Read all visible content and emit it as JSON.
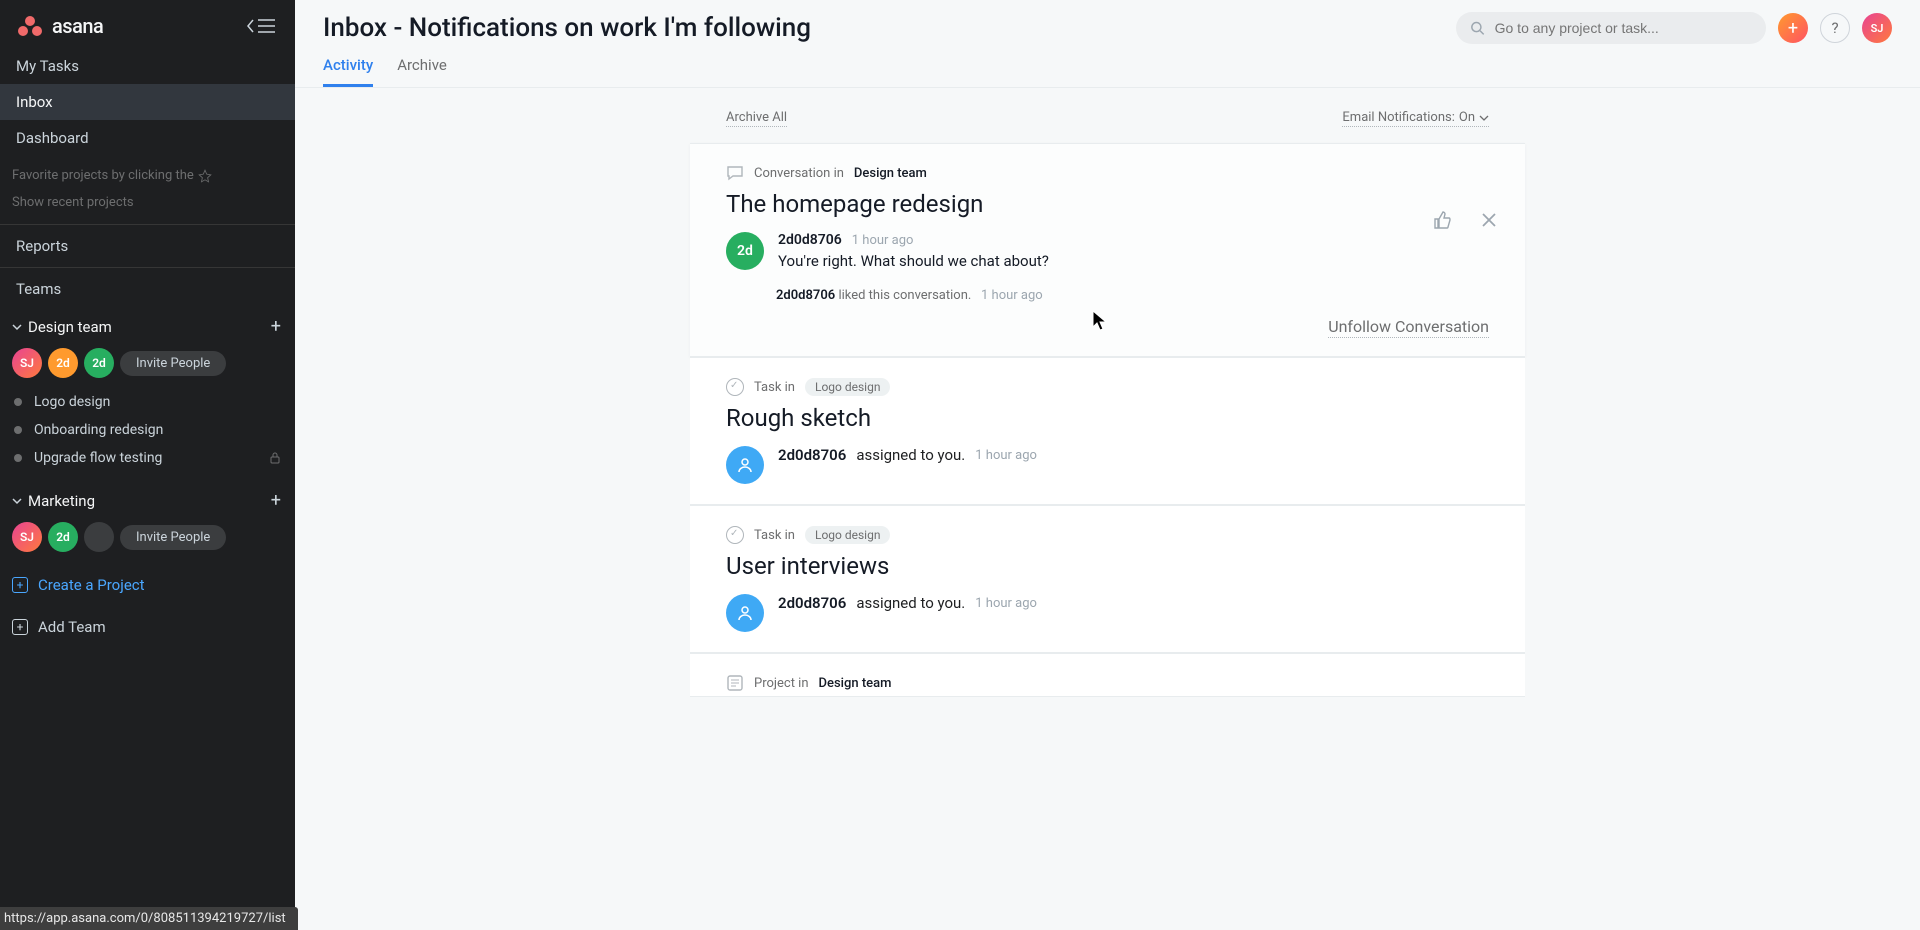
{
  "sidebar": {
    "logo_text": "asana",
    "nav": {
      "my_tasks": "My Tasks",
      "inbox": "Inbox",
      "dashboard": "Dashboard"
    },
    "favorite_hint": "Favorite projects by clicking the",
    "show_recent": "Show recent projects",
    "reports": "Reports",
    "teams_label": "Teams",
    "teams": [
      {
        "name": "Design team",
        "avatars": [
          "SJ",
          "2d",
          "2d"
        ],
        "invite_label": "Invite People",
        "projects": [
          {
            "name": "Logo design",
            "locked": false
          },
          {
            "name": "Onboarding redesign",
            "locked": false
          },
          {
            "name": "Upgrade flow testing",
            "locked": true
          }
        ]
      },
      {
        "name": "Marketing",
        "avatars": [
          "SJ",
          "2d"
        ],
        "invite_label": "Invite People",
        "projects": []
      }
    ],
    "create_project": "Create a Project",
    "add_team": "Add Team"
  },
  "header": {
    "title": "Inbox - Notifications on work I'm following",
    "search_placeholder": "Go to any project or task...",
    "avatar_initials": "SJ"
  },
  "tabs": {
    "activity": "Activity",
    "archive": "Archive"
  },
  "feed_top": {
    "archive_all": "Archive All",
    "email_notif_label": "Email Notifications:",
    "email_notif_state": "On"
  },
  "items": [
    {
      "kind": "conversation",
      "meta_prefix": "Conversation in",
      "meta_loc": "Design team",
      "title": "The homepage redesign",
      "author": "2d0d8706",
      "time": "1 hour ago",
      "comment": "You're right. What should we chat about?",
      "liked_prefix": "2d0d8706",
      "liked_mid": "liked this conversation.",
      "liked_time": "1 hour ago",
      "unfollow": "Unfollow Conversation",
      "avatar_label": "2d"
    },
    {
      "kind": "task",
      "meta_prefix": "Task in",
      "meta_loc": "Logo design",
      "title": "Rough sketch",
      "author": "2d0d8706",
      "assigned_suffix": "assigned to you.",
      "time": "1 hour ago"
    },
    {
      "kind": "task",
      "meta_prefix": "Task in",
      "meta_loc": "Logo design",
      "title": "User interviews",
      "author": "2d0d8706",
      "assigned_suffix": "assigned to you.",
      "time": "1 hour ago"
    },
    {
      "kind": "project",
      "meta_prefix": "Project in",
      "meta_loc": "Design team"
    }
  ],
  "status_url": "https://app.asana.com/0/808511394219727/list"
}
